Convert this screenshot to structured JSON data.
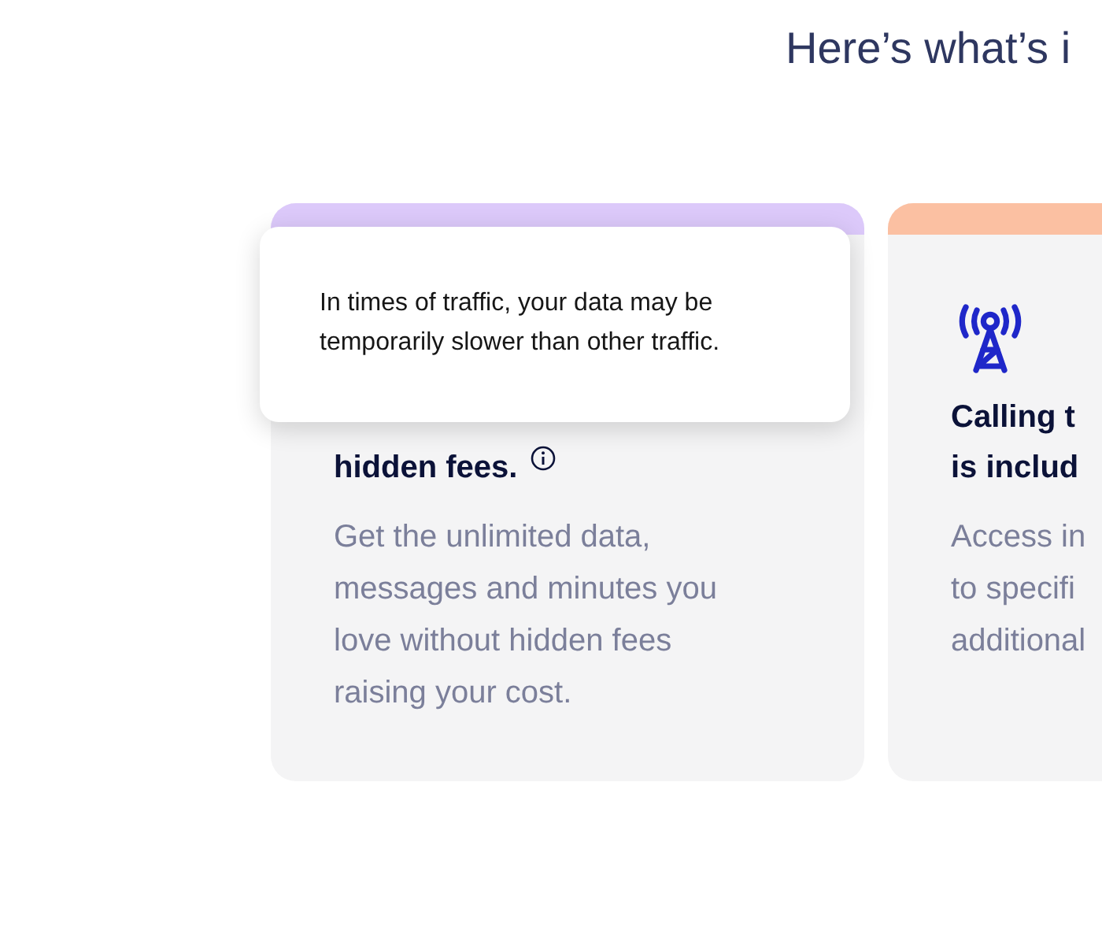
{
  "heading": "Here’s what’s i",
  "cards": [
    {
      "color": "#dcc9fa",
      "info": true,
      "title_lines": [
        "hidden fees."
      ],
      "description_lines": [
        "Get the unlimited data,",
        "messages and minutes you",
        "love without hidden fees",
        "raising your cost."
      ],
      "tooltip": {
        "text": "In times of traffic, your data may be temporarily slower than other traffic."
      }
    },
    {
      "color": "#fbc0a2",
      "title_lines": [
        "Calling t",
        "is includ"
      ],
      "description_lines": [
        "Access in",
        "to specifi",
        "additional"
      ]
    }
  ]
}
